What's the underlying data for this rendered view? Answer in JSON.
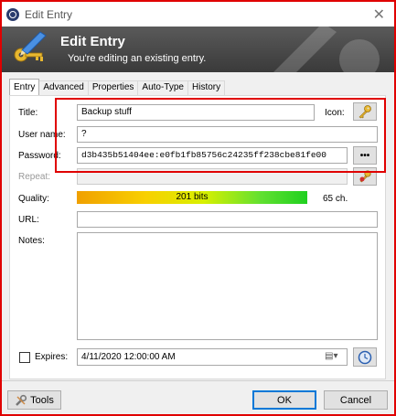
{
  "window": {
    "title": "Edit Entry"
  },
  "banner": {
    "title": "Edit Entry",
    "subtitle": "You're editing an existing entry."
  },
  "tabs": [
    {
      "label": "Entry",
      "active": true
    },
    {
      "label": "Advanced",
      "active": false
    },
    {
      "label": "Properties",
      "active": false
    },
    {
      "label": "Auto-Type",
      "active": false
    },
    {
      "label": "History",
      "active": false
    }
  ],
  "form": {
    "title_label": "Title:",
    "title_value": "Backup stuff",
    "icon_label": "Icon:",
    "username_label": "User name:",
    "username_value": "?",
    "password_label": "Password:",
    "password_value": "d3b435b51404ee:e0fb1fb85756c24235ff238cbe81fe00",
    "password_reveal_label": "•••",
    "repeat_label": "Repeat:",
    "repeat_value": "",
    "quality_label": "Quality:",
    "quality_text": "201 bits",
    "quality_chars": "65 ch.",
    "url_label": "URL:",
    "url_value": "",
    "notes_label": "Notes:",
    "notes_value": "",
    "expires_label": "Expires:",
    "expires_value": "4/11/2020 12:00:00 AM",
    "expires_checked": false
  },
  "footer": {
    "tools_label": "Tools",
    "ok_label": "OK",
    "cancel_label": "Cancel"
  },
  "icons": {
    "app": "lock-icon",
    "banner": "key-pen-icon",
    "entry_icon": "key-icon",
    "repeat_generator": "key-gear-icon",
    "calendar": "calendar-dropdown-icon",
    "expiry_presets": "clock-icon",
    "tools": "wrench-icon"
  },
  "colors": {
    "highlight_box": "#e00000",
    "banner_bg": "#4a4a4a"
  }
}
